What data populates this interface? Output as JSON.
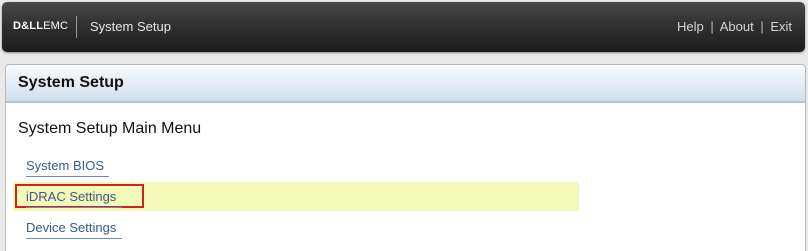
{
  "header": {
    "logo_dell": "D&LL",
    "logo_emc": "EMC",
    "title": "System Setup",
    "links": {
      "help": "Help",
      "about": "About",
      "exit": "Exit",
      "separator": "|"
    }
  },
  "panel": {
    "title": "System Setup",
    "menu_title": "System Setup Main Menu",
    "items": [
      {
        "label": "System BIOS",
        "highlighted": false
      },
      {
        "label": "iDRAC Settings",
        "highlighted": true
      },
      {
        "label": "Device Settings",
        "highlighted": false
      }
    ]
  },
  "colors": {
    "header_bg": "#1c1c1c",
    "link": "#3c5a8a",
    "highlight": "#f4f8b8",
    "annotation_box": "#d42020"
  }
}
